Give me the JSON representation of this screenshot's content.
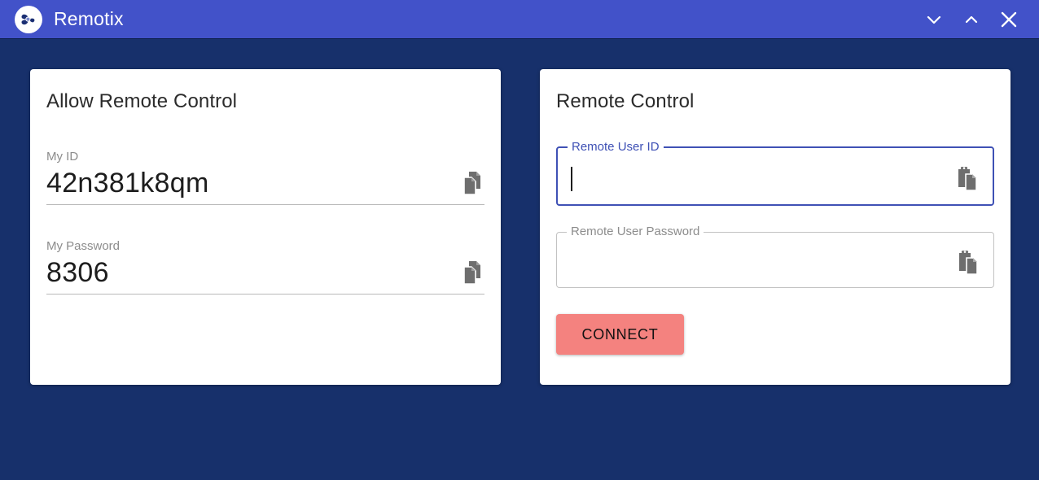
{
  "window": {
    "app_title": "Remotix",
    "logo_icon": "remotix-propeller-logo-icon",
    "titlebar_color": "#4252c9",
    "background_color": "#17306b",
    "controls": {
      "minimize": {
        "icon": "chevron-down-icon",
        "label": "Minimize"
      },
      "maximize": {
        "icon": "chevron-up-icon",
        "label": "Maximize"
      },
      "close": {
        "icon": "close-icon",
        "label": "Close"
      }
    }
  },
  "allow_remote_control": {
    "title": "Allow Remote Control",
    "my_id": {
      "label": "My ID",
      "value": "42n381k8qm",
      "copy_icon": "copy-icon"
    },
    "my_password": {
      "label": "My Password",
      "value": "8306",
      "copy_icon": "copy-icon"
    }
  },
  "remote_control": {
    "title": "Remote Control",
    "remote_user_id": {
      "label": "Remote User ID",
      "value": "",
      "placeholder": "",
      "focused": true,
      "paste_icon": "paste-icon",
      "border_color": "#3f51b5"
    },
    "remote_user_password": {
      "label": "Remote User Password",
      "value": "",
      "placeholder": "",
      "focused": false,
      "paste_icon": "paste-icon",
      "border_color": "#c2c2c2"
    },
    "connect_button": {
      "label": "CONNECT",
      "color": "#f4827f"
    }
  }
}
